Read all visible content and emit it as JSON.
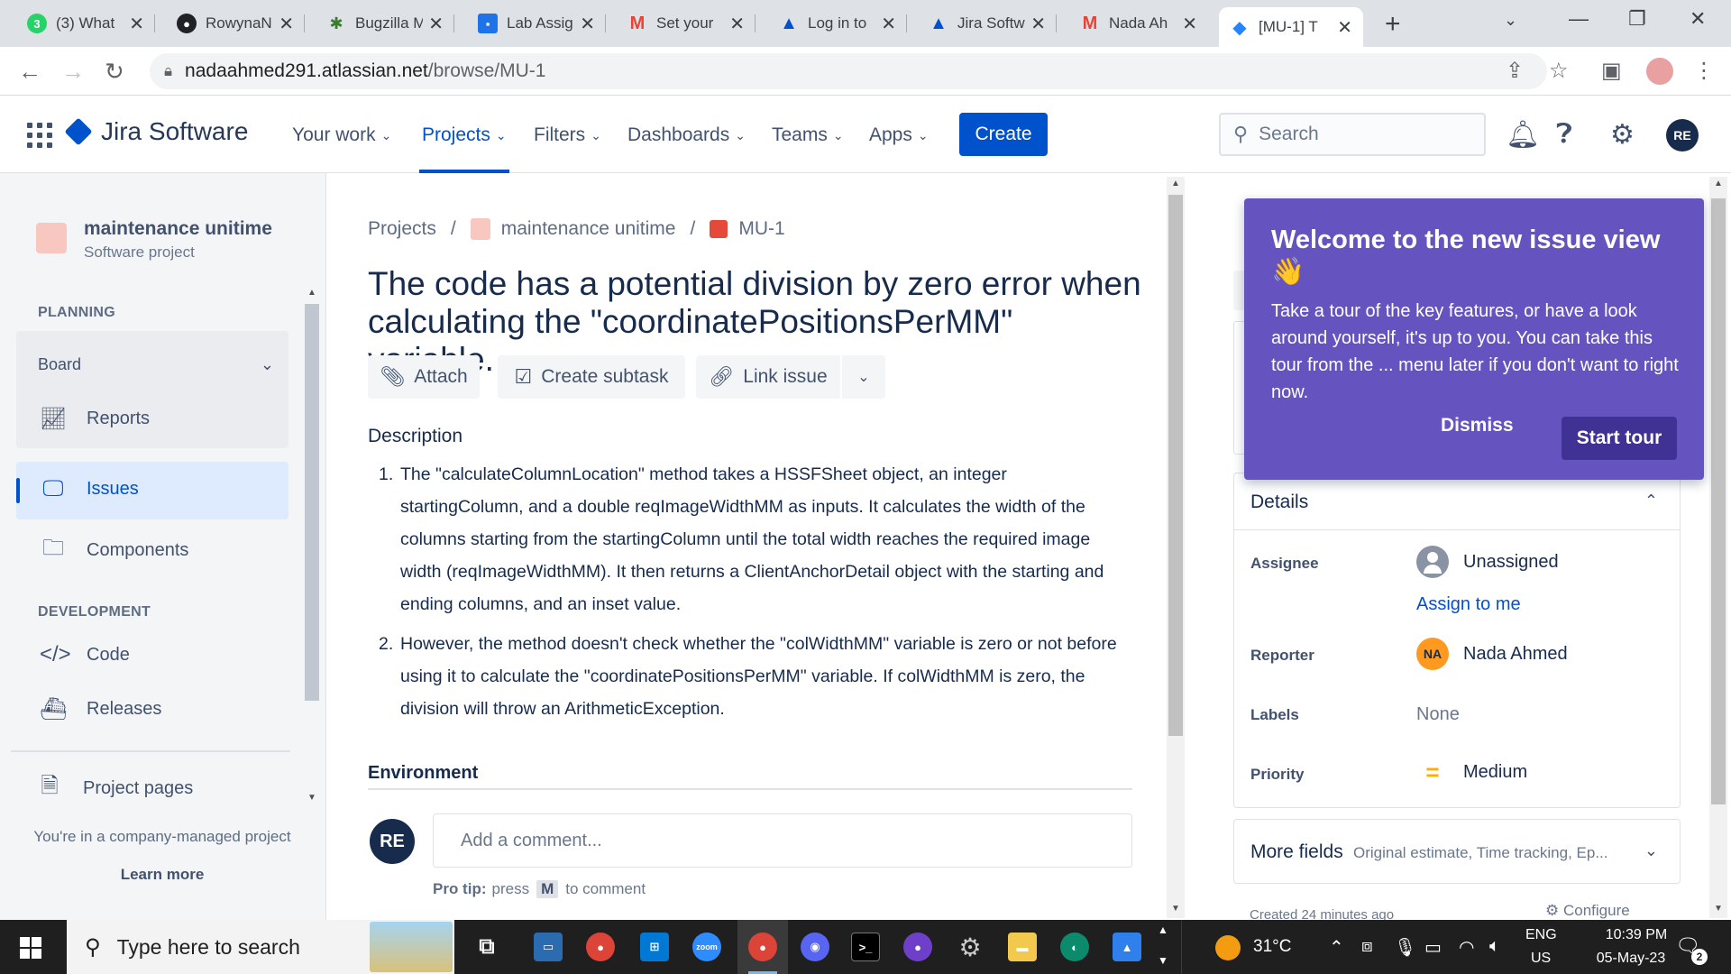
{
  "browser": {
    "tabs": [
      {
        "title": "(3) What",
        "favicon": "whatsapp-icon",
        "favicon_text": "3",
        "color": "#25d366"
      },
      {
        "title": "RowynaN",
        "favicon": "github-icon",
        "color": "#202124"
      },
      {
        "title": "Bugzilla M",
        "favicon": "bugzilla-icon",
        "color": "#3a7d2c"
      },
      {
        "title": "Lab Assig",
        "favicon": "classroom-icon",
        "color": "#1e73e8"
      },
      {
        "title": "Set your",
        "favicon": "gmail-icon",
        "color": "#ea4335"
      },
      {
        "title": "Log in to",
        "favicon": "atlassian-icon",
        "color": "#0052cc"
      },
      {
        "title": "Jira Softw",
        "favicon": "atlassian-icon",
        "color": "#0052cc"
      },
      {
        "title": "Nada Ah",
        "favicon": "gmail-icon",
        "color": "#ea4335"
      },
      {
        "title": "[MU-1] T",
        "favicon": "jira-icon",
        "color": "#2684ff",
        "active": true
      }
    ],
    "url_host": "nadaahmed291.atlassian.net",
    "url_path": "/browse/MU-1"
  },
  "jira_nav": {
    "product": "Jira Software",
    "items": [
      "Your work",
      "Projects",
      "Filters",
      "Dashboards",
      "Teams",
      "Apps"
    ],
    "active_item": "Projects",
    "create_label": "Create",
    "search_placeholder": "Search",
    "user_initials": "RE"
  },
  "sidebar": {
    "project_name": "maintenance unitime",
    "project_type": "Software project",
    "planning_title": "PLANNING",
    "board_label": "Board",
    "reports_label": "Reports",
    "issues_label": "Issues",
    "components_label": "Components",
    "development_title": "DEVELOPMENT",
    "code_label": "Code",
    "releases_label": "Releases",
    "project_pages_label": "Project pages",
    "company_note": "You're in a company-managed project",
    "learn_more": "Learn more"
  },
  "issue": {
    "breadcrumb_projects": "Projects",
    "breadcrumb_project": "maintenance unitime",
    "key": "MU-1",
    "title": "The code has a potential division by zero error when calculating the \"coordinatePositionsPerMM\" variable.",
    "actions": {
      "attach": "Attach",
      "create_subtask": "Create subtask",
      "link_issue": "Link issue"
    },
    "description_label": "Description",
    "description_items": [
      "The \"calculateColumnLocation\" method takes a HSSFSheet object, an integer startingColumn, and a double reqImageWidthMM as inputs. It calculates the width of the columns starting from the startingColumn until the total width reaches the required image width (reqImageWidthMM). It then returns a ClientAnchorDetail object with the starting and ending columns, and an inset value.",
      "However, the method doesn't check whether the \"colWidthMM\" variable is zero or not before using it to calculate the \"coordinatePositionsPerMM\" variable. If colWidthMM is zero, the division will throw an ArithmeticException."
    ],
    "environment_label": "Environment",
    "comment_avatar": "RE",
    "comment_placeholder": "Add a comment...",
    "protip_label": "Pro tip:",
    "protip_press": "press",
    "protip_key": "M",
    "protip_rest": "to comment"
  },
  "popover": {
    "title": "Welcome to the new issue view",
    "emoji": "👋",
    "body": "Take a tour of the key features, or have a look around yourself, it's up to you. You can take this tour from the ... menu later if you don't want to right now.",
    "dismiss": "Dismiss",
    "start_tour": "Start tour"
  },
  "details": {
    "heading": "Details",
    "assignee_label": "Assignee",
    "assignee_value": "Unassigned",
    "assign_to_me": "Assign to me",
    "reporter_label": "Reporter",
    "reporter_initials": "NA",
    "reporter_value": "Nada Ahmed",
    "labels_label": "Labels",
    "labels_value": "None",
    "priority_label": "Priority",
    "priority_value": "Medium",
    "more_fields": "More fields",
    "more_fields_hint": "Original estimate, Time tracking, Ep...",
    "created_note": "Created 24 minutes ago",
    "configure": "Configure"
  },
  "taskbar": {
    "search_placeholder": "Type here to search",
    "temperature": "31°C",
    "lang_top": "ENG",
    "lang_bottom": "US",
    "time": "10:39 PM",
    "date": "05-May-23",
    "notification_count": "2"
  }
}
